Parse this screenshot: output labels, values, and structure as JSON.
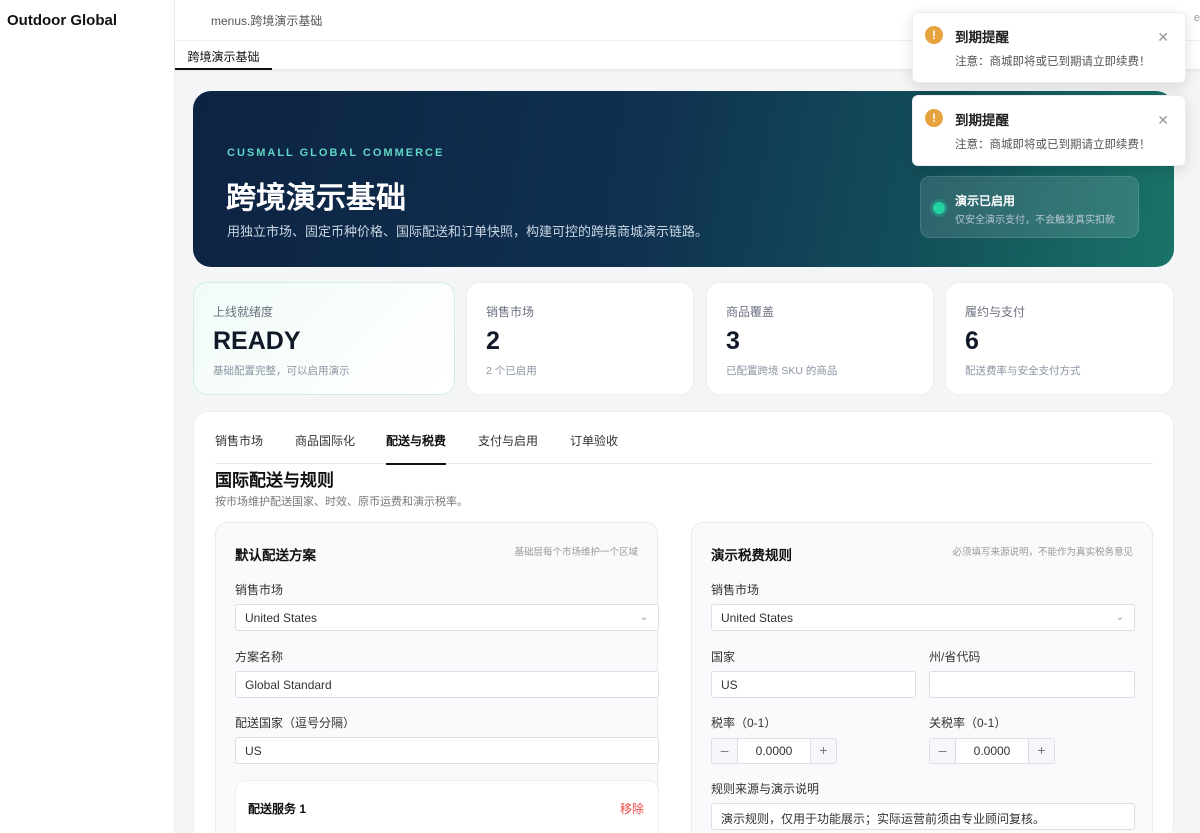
{
  "app": {
    "brand": "Outdoor Global"
  },
  "header": {
    "breadcrumb": "menus.跨境演示基础",
    "edge": "e",
    "tab": "跨境演示基础"
  },
  "hero": {
    "kicker": "CUSMALL GLOBAL COMMERCE",
    "title": "跨境演示基础",
    "desc": "用独立市场、固定币种价格、国际配送和订单快照，构建可控的跨境商城演示链路。",
    "status_title": "演示已启用",
    "status_sub": "仅安全演示支付，不会触发真实扣款"
  },
  "stats": [
    {
      "label": "上线就绪度",
      "value": "READY",
      "sub": "基础配置完整，可以启用演示"
    },
    {
      "label": "销售市场",
      "value": "2",
      "sub": "2 个已启用"
    },
    {
      "label": "商品覆盖",
      "value": "3",
      "sub": "已配置跨境 SKU 的商品"
    },
    {
      "label": "履约与支付",
      "value": "6",
      "sub": "配送费率与安全支付方式"
    }
  ],
  "panel": {
    "tabs": [
      "销售市场",
      "商品国际化",
      "配送与税费",
      "支付与启用",
      "订单验收"
    ],
    "active_tab": "配送与税费",
    "title": "国际配送与规则",
    "desc": "按市场维护配送国家、时效、原币运费和演示税率。"
  },
  "shipping": {
    "title": "默认配送方案",
    "note": "基础层每个市场维护一个区域",
    "market_label": "销售市场",
    "market_value": "United States",
    "plan_label": "方案名称",
    "plan_value": "Global Standard",
    "countries_label": "配送国家（逗号分隔）",
    "countries_value": "US",
    "service_title": "配送服务 1",
    "remove_label": "移除"
  },
  "tax": {
    "title": "演示税费规则",
    "note": "必须填写来源说明，不能作为真实税务意见",
    "market_label": "销售市场",
    "market_value": "United States",
    "country_label": "国家",
    "country_value": "US",
    "state_label": "州/省代码",
    "state_value": "",
    "rate_label": "税率（0-1）",
    "rate_value": "0.0000",
    "duty_label": "关税率（0-1）",
    "duty_value": "0.0000",
    "source_label": "规则来源与演示说明",
    "source_value": "演示规则，仅用于功能展示；实际运营前须由专业顾问复核。"
  },
  "notifications": [
    {
      "title": "到期提醒",
      "message": "注意：商城即将或已到期请立即续费！"
    },
    {
      "title": "到期提醒",
      "message": "注意：商城即将或已到期请立即续费！"
    }
  ],
  "icons": {
    "warning": "warning-icon",
    "close": "close-icon",
    "chevron": "chevron-down-icon",
    "minus": "minus-icon",
    "plus": "plus-icon"
  },
  "colors": {
    "accent": "#5fd6c5",
    "status_dot": "#22d3a0",
    "danger": "#ef4444",
    "warn": "#e6a23c"
  }
}
